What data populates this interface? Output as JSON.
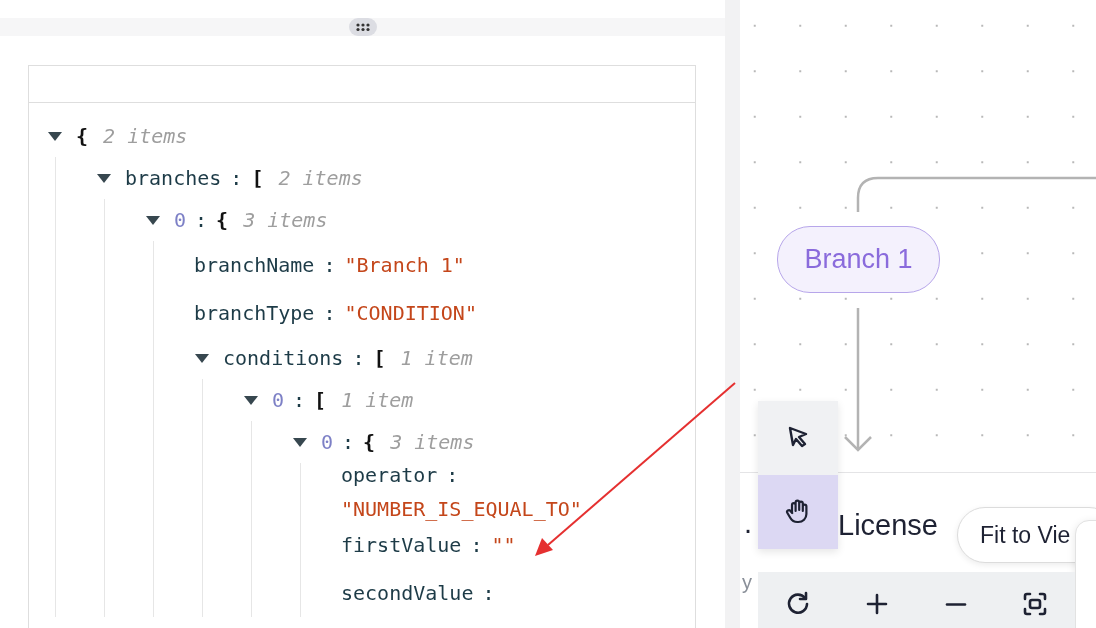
{
  "json_viewer": {
    "root": {
      "bracket": "{",
      "count": "2 items",
      "expanded": true,
      "children": [
        {
          "key": "branches",
          "separator": ":",
          "kind": "property",
          "bracket": "[",
          "count": "2 items",
          "expanded": true,
          "children": [
            {
              "key": "0",
              "separator": ":",
              "kind": "index",
              "bracket": "{",
              "count": "3 items",
              "expanded": true,
              "children": [
                {
                  "key": "branchName",
                  "separator": ":",
                  "kind": "property",
                  "value": "\"Branch 1\""
                },
                {
                  "key": "branchType",
                  "separator": ":",
                  "kind": "property",
                  "value": "\"CONDITION\""
                },
                {
                  "key": "conditions",
                  "separator": ":",
                  "kind": "property",
                  "bracket": "[",
                  "count": "1 item",
                  "expanded": true,
                  "children": [
                    {
                      "key": "0",
                      "separator": ":",
                      "kind": "index",
                      "bracket": "[",
                      "count": "1 item",
                      "expanded": true,
                      "children": [
                        {
                          "key": "0",
                          "separator": ":",
                          "kind": "index",
                          "bracket": "{",
                          "count": "3 items",
                          "expanded": true,
                          "children": [
                            {
                              "key": "operator",
                              "separator": ":",
                              "kind": "property",
                              "value": "\"NUMBER_IS_EQUAL_TO\""
                            },
                            {
                              "key": "firstValue",
                              "separator": ":",
                              "kind": "property",
                              "value": "\"\""
                            },
                            {
                              "key": "secondValue",
                              "separator": ":",
                              "kind": "property"
                            }
                          ]
                        }
                      ]
                    }
                  ]
                }
              ]
            }
          ]
        }
      ]
    }
  },
  "canvas": {
    "nodes": [
      {
        "label": "Branch 1"
      }
    ],
    "bottom_panel": {
      "text_1": ".",
      "text_2": "License",
      "text_3": "y"
    },
    "tools": [
      {
        "kind": "pointer",
        "selected": false
      },
      {
        "kind": "hand",
        "selected": true
      }
    ],
    "tooltip": "Fit to Vie",
    "zoom_controls": [
      {
        "kind": "reset"
      },
      {
        "kind": "zoom_in"
      },
      {
        "kind": "zoom_out"
      },
      {
        "kind": "fit"
      }
    ]
  }
}
